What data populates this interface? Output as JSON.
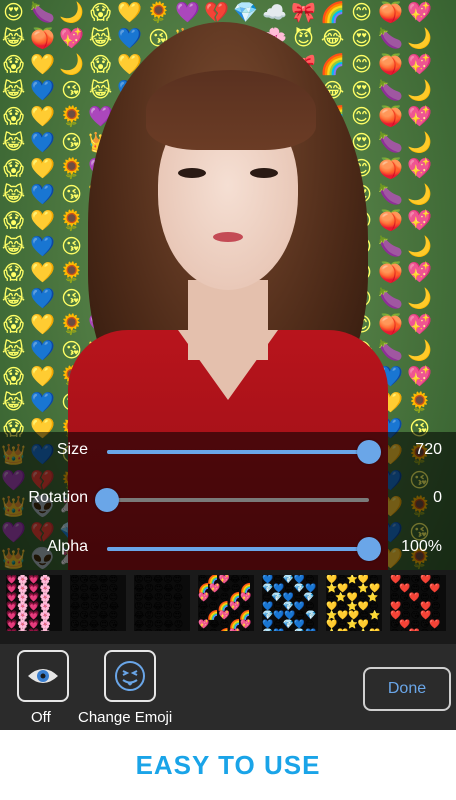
{
  "sliders": [
    {
      "label": "Size",
      "value_text": "720",
      "level": 1.0
    },
    {
      "label": "Rotation",
      "value_text": "0",
      "level": 0.0
    },
    {
      "label": "Alpha",
      "value_text": "100%",
      "level": 1.0
    }
  ],
  "emoji_fill": [
    "😍",
    "💔",
    "💖",
    "🌸",
    "💛",
    "🌈",
    "👑",
    "🍆",
    "💎",
    "😹",
    "😈",
    "🌻",
    "😊",
    "👽",
    "🌙",
    "☁️",
    "💙",
    "😂",
    "💜",
    "🍑",
    "🦄",
    "😱",
    "🎀",
    "😘"
  ],
  "packs": [
    {
      "name": "hearts-pack",
      "glyphs": "💗🌸💗🌸💗🌸💗🌸💗🌸💗🌸💗🌸💗🌸💗🌸💗🌸💗🌸💗🌸"
    },
    {
      "name": "smiley-pack",
      "glyphs": "😍😘😊😂😍😘😊😂😍😘😊😂😍😘😊😂😍😘😊😂😍😘😊😂"
    },
    {
      "name": "red-smiley-pack",
      "glyphs": "😡😍😂😡😍😂😡😍😂😡😍😂😡😍😂😡😍😂😡😍😂😡😍"
    },
    {
      "name": "mixed-pack",
      "glyphs": "😍🌈💖😂😍🌈💖😂😍🌈💖😂😍🌈💖😂😍🌈💖😂😍🌈💖"
    },
    {
      "name": "blue-pack",
      "glyphs": "💙😊💎💙😊💎💙😊💎💙😊💎💙😊💎💙😊💎💙😊💎💙"
    },
    {
      "name": "yellow-pack",
      "glyphs": "💛😊⭐💛😊⭐💛😊⭐💛😊⭐💛😊⭐💛😊⭐💛😊⭐💛"
    },
    {
      "name": "love-pack",
      "glyphs": "❤️😍😘❤️😍😘❤️😍😘❤️😍😘❤️😍😘❤️😍😘❤️😍"
    }
  ],
  "toolbar": {
    "toggle_label": "Off",
    "change_label": "Change Emoji",
    "done_label": "Done"
  },
  "footer": {
    "title": "EASY TO USE"
  },
  "colors": {
    "accent": "#6aa6e8",
    "caption": "#1aa4e8"
  }
}
